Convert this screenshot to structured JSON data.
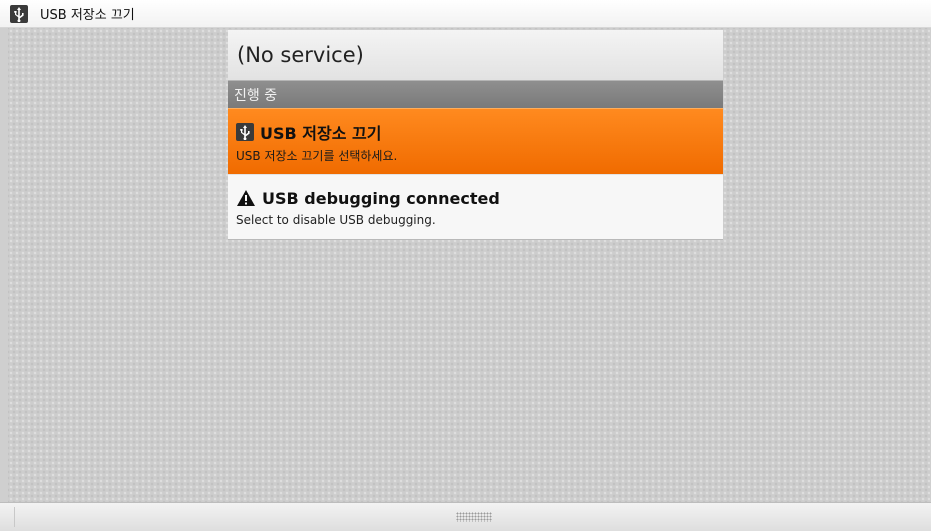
{
  "status_bar": {
    "icon": "usb-icon",
    "title": "USB 저장소 끄기"
  },
  "panel": {
    "carrier": "(No service)",
    "section_header": "진행 중",
    "notifications": [
      {
        "icon": "usb-icon",
        "title": "USB 저장소 끄기",
        "text": "USB 저장소 끄기를 선택하세요.",
        "highlighted": true,
        "color": "#f57a10"
      },
      {
        "icon": "warning-icon",
        "title": "USB debugging connected",
        "text": "Select to disable USB debugging.",
        "highlighted": false,
        "color": "#f7f7f7"
      }
    ]
  },
  "bottom_bar": {
    "handle": "grip-handle"
  }
}
